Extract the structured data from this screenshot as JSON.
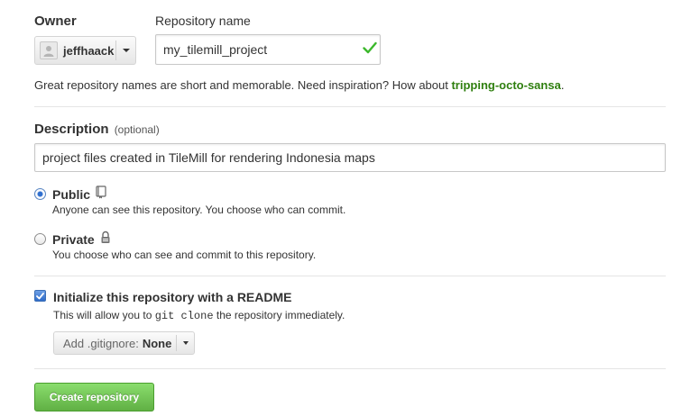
{
  "owner": {
    "label": "Owner",
    "selected": "jeffhaack",
    "avatar_icon": "user-avatar-icon"
  },
  "repository": {
    "label": "Repository name",
    "value": "my_tilemill_project",
    "valid_icon": "checkmark-icon"
  },
  "hint": {
    "text": "Great repository names are short and memorable. Need inspiration? How about ",
    "suggestion": "tripping-octo-sansa",
    "end": "."
  },
  "description": {
    "label": "Description",
    "optional": "(optional)",
    "value": "project files created in TileMill for rendering Indonesia maps"
  },
  "visibility": {
    "public_label": "Public",
    "public_desc": "Anyone can see this repository. You choose who can commit.",
    "public_icon": "repo-book-icon",
    "private_label": "Private",
    "private_desc": "You choose who can see and commit to this repository.",
    "private_icon": "lock-icon",
    "selected": "Public"
  },
  "readme": {
    "label": "Initialize this repository with a README",
    "desc_before": "This will allow you to ",
    "desc_code": "git clone",
    "desc_after": " the repository immediately.",
    "checked": true
  },
  "gitignore": {
    "label": "Add .gitignore:",
    "value": "None"
  },
  "submit": {
    "label": "Create repository"
  },
  "colors": {
    "accent_green": "#60b044",
    "suggestion_green": "#2f7f0f",
    "check_green": "#3cb82c",
    "radio_blue": "#2f6fcf"
  }
}
